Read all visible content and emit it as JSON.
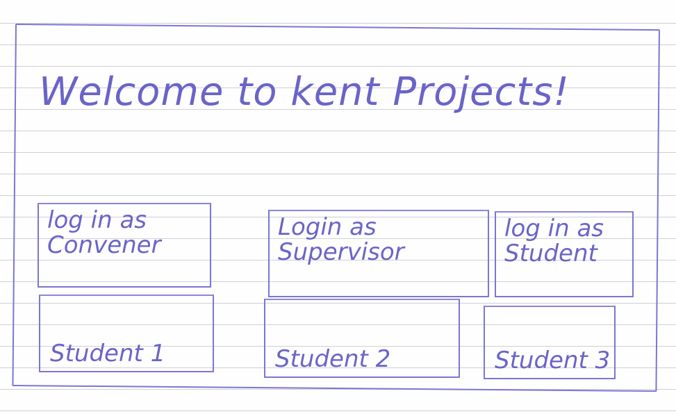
{
  "header": {
    "title": "Welcome to kent Projects!"
  },
  "login_buttons": {
    "convener": "log in as\nConvener",
    "supervisor": "Login as\nSupervisor",
    "student": "log in as\nStudent"
  },
  "students": [
    {
      "label": "Student 1"
    },
    {
      "label": "Student 2"
    },
    {
      "label": "Student 3"
    }
  ],
  "colors": {
    "ink": "#6a64c8",
    "ruled_line": "#cfcfd6",
    "paper": "#fefefe"
  }
}
